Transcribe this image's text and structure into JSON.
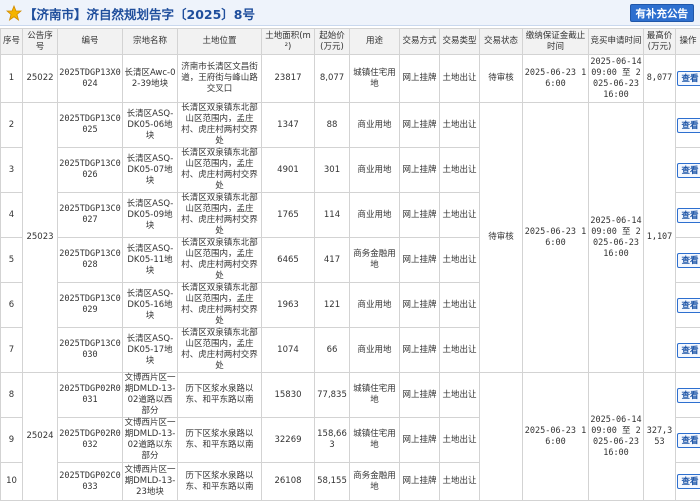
{
  "header": {
    "title": "【济南市】济自然规划告字〔2025〕8号",
    "supplement_button": "有补充公告"
  },
  "table": {
    "columns": [
      "序号",
      "公告序号",
      "编号",
      "宗地名称",
      "土地位置",
      "土地面积(m²)",
      "起始价(万元)",
      "用途",
      "交易方式",
      "交易类型",
      "交易状态",
      "缴纳保证金截止时间",
      "竞买申请时间",
      "最高价(万元)",
      "操作"
    ],
    "view_label": "查看",
    "rows": [
      {
        "seq": "1",
        "notice": "25022",
        "code": "2025TDGP13X0024",
        "name": "长清区Awc-02-39地块",
        "location": "济南市长清区文昌街道，王府街与峰山路交叉口",
        "area": "23817",
        "price": "8,077",
        "use": "城镇住宅用地",
        "method": "网上挂牌",
        "type": "土地出让",
        "status": "待审核",
        "deadline": "2025-06-23 16:00",
        "apply": "2025-06-14 09:00 至 2025-06-23 16:00",
        "maxprice": "8,077"
      },
      {
        "seq": "2",
        "code": "2025TDGP13C0025",
        "name": "长清区ASQ-DK05-06地块",
        "location": "长清区双泉镇东北部山区范围内，孟庄村、虎庄村两村交界处",
        "area": "1347",
        "price": "88",
        "use": "商业用地",
        "method": "网上挂牌",
        "type": "土地出让"
      },
      {
        "seq": "3",
        "code": "2025TDGP13C0026",
        "name": "长清区ASQ-DK05-07地块",
        "location": "长清区双泉镇东北部山区范围内，孟庄村、虎庄村两村交界处",
        "area": "4901",
        "price": "301",
        "use": "商业用地",
        "method": "网上挂牌",
        "type": "土地出让"
      },
      {
        "seq": "4",
        "code": "2025TDGP13C0027",
        "name": "长清区ASQ-DK05-09地块",
        "location": "长清区双泉镇东北部山区范围内，孟庄村、虎庄村两村交界处",
        "area": "1765",
        "price": "114",
        "use": "商业用地",
        "method": "网上挂牌",
        "type": "土地出让"
      },
      {
        "seq": "5",
        "code": "2025TDGP13C0028",
        "name": "长清区ASQ-DK05-11地块",
        "location": "长清区双泉镇东北部山区范围内，孟庄村、虎庄村两村交界处",
        "area": "6465",
        "price": "417",
        "use": "商务金融用地",
        "method": "网上挂牌",
        "type": "土地出让"
      },
      {
        "seq": "6",
        "code": "2025TDGP13C0029",
        "name": "长清区ASQ-DK05-16地块",
        "location": "长清区双泉镇东北部山区范围内，孟庄村、虎庄村两村交界处",
        "area": "1963",
        "price": "121",
        "use": "商业用地",
        "method": "网上挂牌",
        "type": "土地出让"
      },
      {
        "seq": "7",
        "code": "2025TDGP13C0030",
        "name": "长清区ASQ-DK05-17地块",
        "location": "长清区双泉镇东北部山区范围内，孟庄村、虎庄村两村交界处",
        "area": "1074",
        "price": "66",
        "use": "商业用地",
        "method": "网上挂牌",
        "type": "土地出让"
      },
      {
        "seq": "8",
        "code": "2025TDGP02R0031",
        "name": "文博西片区一期DMLD-13-02道路以西部分",
        "location": "历下区浆水泉路以东、和平东路以南",
        "area": "15830",
        "price": "77,835",
        "use": "城镇住宅用地",
        "method": "网上挂牌",
        "type": "土地出让"
      },
      {
        "seq": "9",
        "code": "2025TDGP02R0032",
        "name": "文博西片区一期DMLD-13-02道路以东部分",
        "location": "历下区浆水泉路以东、和平东路以南",
        "area": "32269",
        "price": "158,663",
        "use": "城镇住宅用地",
        "method": "网上挂牌",
        "type": "土地出让"
      },
      {
        "seq": "10",
        "code": "2025TDGP02C0033",
        "name": "文博西片区一期DMLD-13-23地块",
        "location": "历下区浆水泉路以东、和平东路以南",
        "area": "26108",
        "price": "58,155",
        "use": "商务金融用地",
        "method": "网上挂牌",
        "type": "土地出让"
      }
    ],
    "group_25023": {
      "notice": "25023",
      "status": "待审核",
      "deadline": "2025-06-23 16:00",
      "apply": "2025-06-14 09:00 至 2025-06-23 16:00",
      "maxprice": "1,107"
    },
    "group_25024": {
      "notice": "25024",
      "deadline": "2025-06-23 16:00",
      "apply": "2025-06-14 09:00 至 2025-06-23 16:00",
      "maxprice": "327,353"
    }
  }
}
